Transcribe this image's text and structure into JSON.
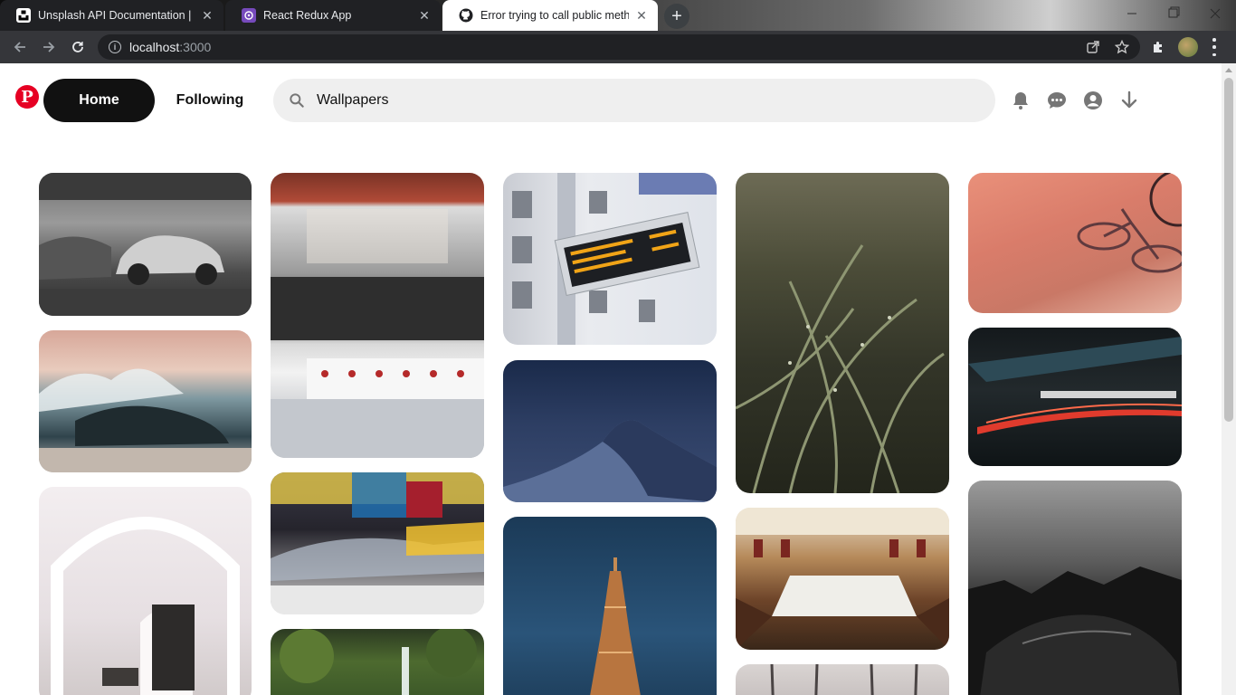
{
  "browser": {
    "tabs": [
      {
        "title": "Unsplash API Documentation | Fr",
        "favicon": "unsplash-icon"
      },
      {
        "title": "React Redux App",
        "favicon": "redux-icon"
      },
      {
        "title": "Error trying to call public metho",
        "favicon": "github-icon"
      }
    ],
    "newtab_label": "+",
    "close_label": "✕",
    "address": {
      "host": "localhost",
      "port": ":3000"
    }
  },
  "header": {
    "logo": "P",
    "nav": {
      "home": "Home",
      "following": "Following"
    },
    "search": {
      "value": "Wallpapers",
      "placeholder": "Search"
    },
    "icons": [
      "bell-icon",
      "chat-icon",
      "account-icon",
      "download-arrow-icon"
    ]
  },
  "colors": {
    "brand": "#e60023",
    "active_nav": "#111111",
    "search_bg": "#efefef"
  },
  "feed": {
    "pins": [
      {
        "subject": "vintage-car-garage",
        "column": 1
      },
      {
        "subject": "ocean-wave-sunset",
        "column": 1
      },
      {
        "subject": "white-arched-hallway",
        "column": 1
      },
      {
        "subject": "diner-kitchen",
        "column": 2
      },
      {
        "subject": "times-square-traffic",
        "column": 2
      },
      {
        "subject": "waterfall-forest",
        "column": 2
      },
      {
        "subject": "departure-sign",
        "column": 3
      },
      {
        "subject": "blue-sand-dune",
        "column": 3
      },
      {
        "subject": "eiffel-tower",
        "column": 3
      },
      {
        "subject": "grass-dew",
        "column": 4
      },
      {
        "subject": "assembly-hall",
        "column": 4
      },
      {
        "subject": "bare-trees",
        "column": 4
      },
      {
        "subject": "bicycle-shadow",
        "column": 5
      },
      {
        "subject": "light-trails-tunnel",
        "column": 5
      },
      {
        "subject": "black-car-silhouette",
        "column": 5
      }
    ]
  }
}
